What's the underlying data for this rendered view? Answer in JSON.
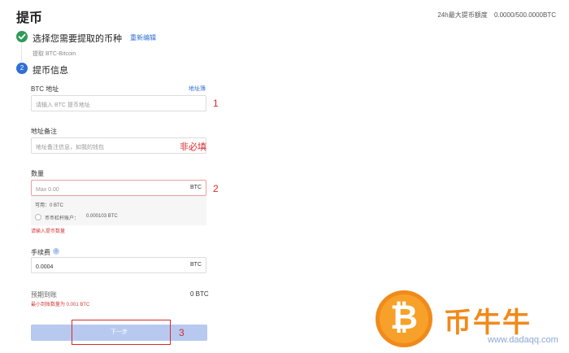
{
  "header": {
    "title": "提币",
    "limit_label": "24h最大提币额度",
    "limit_value": "0.0000/500.0000BTC"
  },
  "step1": {
    "title": "选择您需要提取的币种",
    "reedit": "重新编辑",
    "selected": "提取 BTC-Bitcoin"
  },
  "step2": {
    "number": "2",
    "title": "提币信息"
  },
  "address": {
    "label": "BTC 地址",
    "book_link": "地址簿",
    "placeholder": "请输入 BTC 提币地址",
    "annotation": "1"
  },
  "memo": {
    "label": "地址备注",
    "placeholder": "地址备注信息，如我的钱包",
    "annotation": "非必填"
  },
  "amount": {
    "label": "数量",
    "placeholder": "Max 0.00",
    "unit": "BTC",
    "annotation": "2",
    "available": "可用：0 BTC",
    "margin_label": "币币杠杆账户：",
    "margin_value": "0.000103 BTC",
    "error": "请输入提币数量"
  },
  "fee": {
    "label": "手续费",
    "value": "0.0004",
    "unit": "BTC",
    "info_icon": "info-icon"
  },
  "receive": {
    "label": "预期到账",
    "value": "0 BTC",
    "min_note": "最小到账数量为 0.001 BTC"
  },
  "submit": {
    "label": "下一步",
    "annotation": "3"
  },
  "watermark": {
    "brand": "币牛牛",
    "url": "www.dadaqq.com",
    "coin_glyph": "₿"
  },
  "colors": {
    "primary": "#2f6fd6",
    "success": "#2e9a57",
    "annotation": "#d62a2a",
    "watermark_orange": "#f08a1a"
  }
}
